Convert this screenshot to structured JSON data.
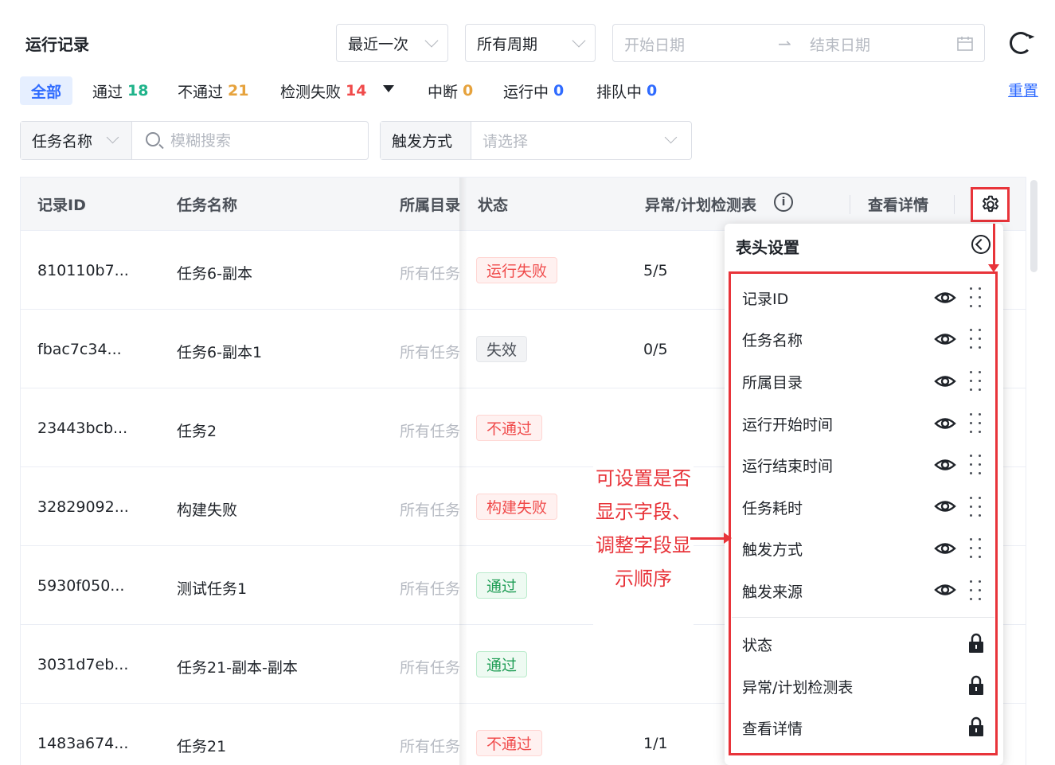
{
  "header": {
    "title": "运行记录",
    "recent_select": "最近一次",
    "period_select": "所有周期",
    "date_start_placeholder": "开始日期",
    "date_end_placeholder": "结束日期",
    "date_arrow": "⇀"
  },
  "filters": {
    "all": "全部",
    "pass_label": "通过",
    "pass_count": "18",
    "fail_label": "不通过",
    "fail_count": "21",
    "error_label": "检测失败",
    "error_count": "14",
    "interrupt_label": "中断",
    "interrupt_count": "0",
    "running_label": "运行中",
    "running_count": "0",
    "queue_label": "排队中",
    "queue_count": "0",
    "reset": "重置",
    "colors": {
      "pass": "#1fb38a",
      "fail": "#e6a23c",
      "error": "#f04b4b",
      "zero": "#2f6bff"
    }
  },
  "search": {
    "type_label": "任务名称",
    "placeholder": "模糊搜索",
    "trigger_label": "触发方式",
    "trigger_placeholder": "请选择"
  },
  "table": {
    "columns": {
      "id": "记录ID",
      "name": "任务名称",
      "dir": "所属目录",
      "status": "状态",
      "check": "异常/计划检测表",
      "detail": "查看详情"
    },
    "rows": [
      {
        "id": "810110b7...",
        "name": "任务6-副本",
        "dir": "所有任务",
        "status": "运行失败",
        "status_type": "red",
        "check": "5/5"
      },
      {
        "id": "fbac7c34...",
        "name": "任务6-副本1",
        "dir": "所有任务",
        "status": "失效",
        "status_type": "gray",
        "check": "0/5"
      },
      {
        "id": "23443bcb...",
        "name": "任务2",
        "dir": "所有任务",
        "status": "不通过",
        "status_type": "red",
        "check": ""
      },
      {
        "id": "32829092...",
        "name": "构建失败",
        "dir": "所有任务",
        "status": "构建失败",
        "status_type": "red",
        "check": ""
      },
      {
        "id": "5930f050...",
        "name": "测试任务1",
        "dir": "所有任务",
        "status": "通过",
        "status_type": "green",
        "check": ""
      },
      {
        "id": "3031d7eb...",
        "name": "任务21-副本-副本",
        "dir": "所有任务",
        "status": "通过",
        "status_type": "green",
        "check": ""
      },
      {
        "id": "1483a674...",
        "name": "任务21",
        "dir": "所有任务",
        "status": "不通过",
        "status_type": "red",
        "check": "1/1"
      }
    ]
  },
  "column_settings": {
    "title": "表头设置",
    "visible_fields": [
      "记录ID",
      "任务名称",
      "所属目录",
      "运行开始时间",
      "运行结束时间",
      "任务耗时",
      "触发方式",
      "触发来源"
    ],
    "locked_fields": [
      "状态",
      "异常/计划检测表",
      "查看详情"
    ]
  },
  "annotation": {
    "text": "可设置是否显示字段、调整字段显示顺序",
    "color": "#e8343a"
  }
}
